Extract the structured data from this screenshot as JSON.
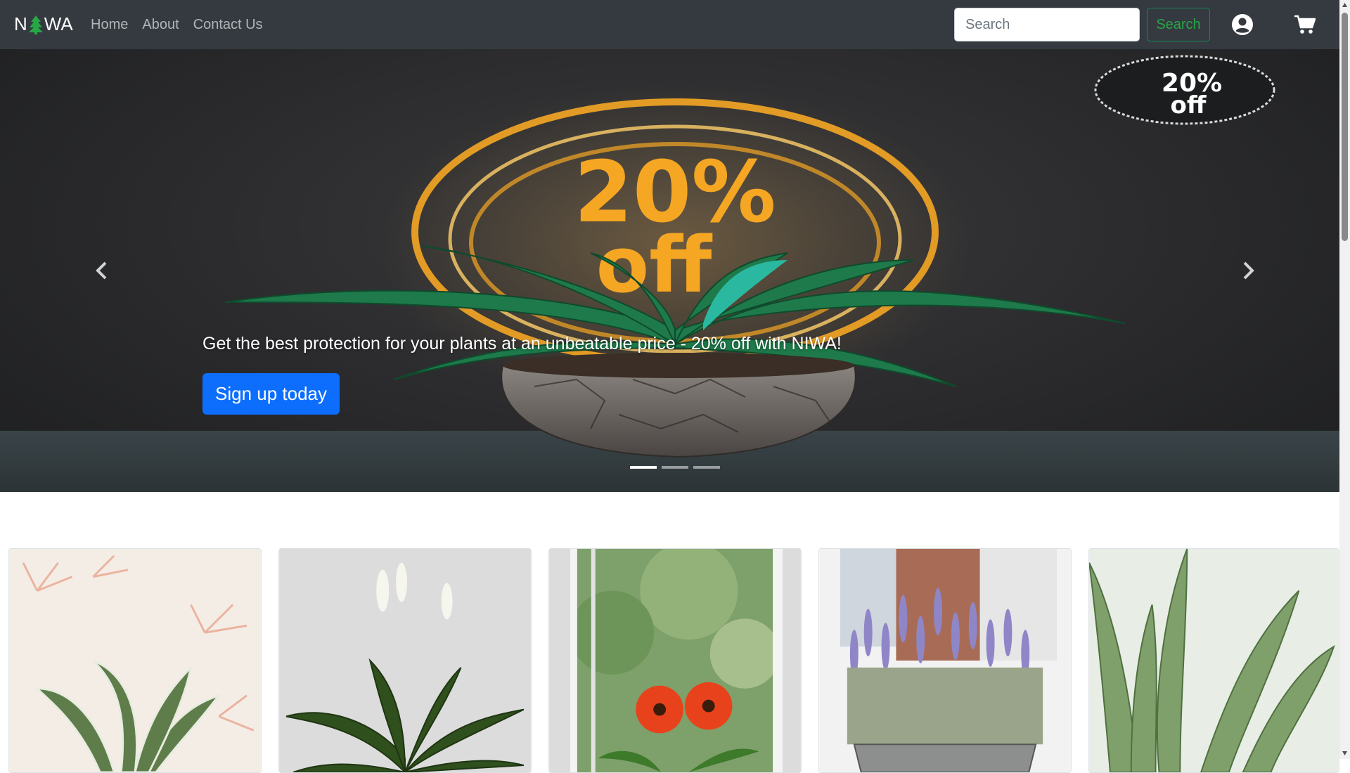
{
  "navbar": {
    "brand_prefix": "N",
    "brand_suffix": "WA",
    "links": [
      "Home",
      "About",
      "Contact Us"
    ],
    "search_placeholder": "Search",
    "search_button": "Search"
  },
  "carousel": {
    "caption": "Get the best protection for your plants at an unbeatable price - 20% off with NIWA!",
    "cta_label": "Sign up today",
    "badge_text_top": "20%",
    "badge_text_bottom": "off",
    "slide_count": 3,
    "active_slide": 1
  },
  "products": [
    {
      "image": "variegated-aglaonema-plant-photo"
    },
    {
      "image": "peace-lily-plant-photo"
    },
    {
      "image": "red-gerbera-daisy-photo"
    },
    {
      "image": "lavender-pot-photo"
    },
    {
      "image": "aloe-vera-plant-photo"
    }
  ],
  "colors": {
    "navbar_bg": "#343a40",
    "cta_blue": "#0d6efd",
    "search_green": "#198754",
    "promo_orange": "#f5a623"
  }
}
